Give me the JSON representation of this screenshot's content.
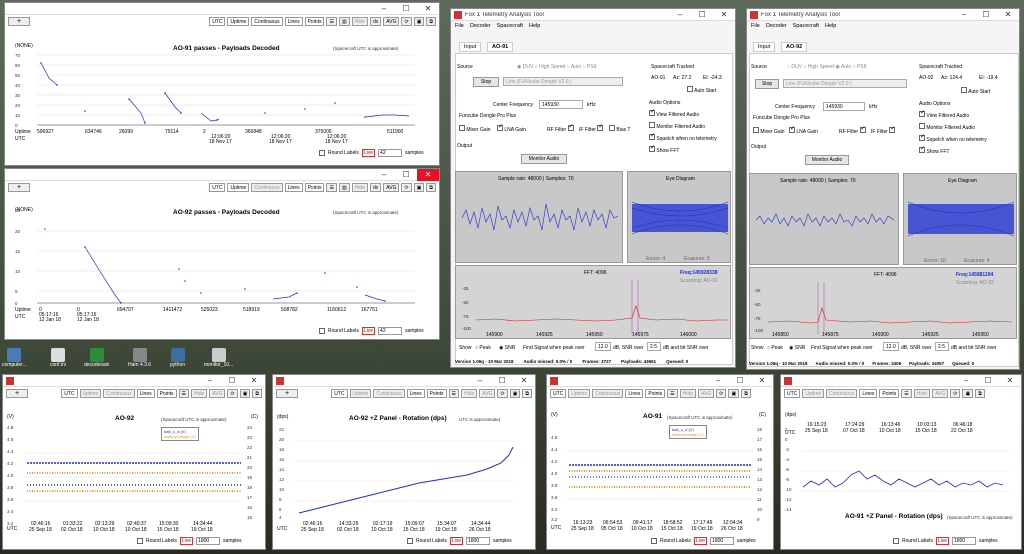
{
  "desktop_icons": [
    "computer...",
    "conf.ini",
    "decodesalx",
    "Ham 4.3.6",
    "python",
    "monitor_10..."
  ],
  "w1": {
    "title": "AO-91 passes - Payloads Decoded",
    "note": "(Spacecraft UTC is approximate)",
    "ylabel": "(NONE)",
    "yticks": [
      "70",
      "60",
      "50",
      "40",
      "30",
      "20",
      "10",
      "0"
    ],
    "toolbar": [
      "UTC",
      "Uptime",
      "Continuous",
      "Lines",
      "Points",
      "Hide",
      "AVG"
    ],
    "xlabels_top": [
      "Uptime",
      "596927",
      "634746",
      "26099",
      "79114",
      "2",
      "366848",
      "375006",
      "511900"
    ],
    "xlabels_utc": [
      "UTC",
      "12:06:20",
      "12:06:20",
      "12:06:20"
    ],
    "xlabels_date": [
      "18 Nov 17",
      "18 Nov 17",
      "18 Nov 17"
    ],
    "round_labels": "Round Labels",
    "live": "Live",
    "samples_value": "42",
    "samples": "samples"
  },
  "w2": {
    "title": "AO-92 passes - Payloads Decoded",
    "note": "(Spacecraft UTC is approximate)",
    "ylabel": "(NONE)",
    "yticks": [
      "25",
      "20",
      "15",
      "10",
      "5",
      "0"
    ],
    "toolbar": [
      "UTC",
      "Uptime",
      "Continuous",
      "Lines",
      "Points",
      "Hide",
      "AVG"
    ],
    "xlabels_top": [
      "Uptime",
      "0",
      "0",
      "694707",
      "1411472",
      "525023",
      "518919",
      "508782",
      "1160612",
      "167751"
    ],
    "xlabels_utc": [
      "UTC",
      "05:17:16",
      "05:17:16"
    ],
    "xlabels_date": [
      "12 Jan 18",
      "12 Jan 18"
    ],
    "round_labels": "Round Labels",
    "live": "Live",
    "samples_value": "42",
    "samples": "samples"
  },
  "f1": {
    "title": "Fox 1 Telemetry Analysis Tool",
    "menu": [
      "File",
      "Decoder",
      "Spacecraft",
      "Help"
    ],
    "tabs": [
      "Input",
      "AO-91"
    ],
    "source": "Source",
    "modes": [
      "DUV",
      "High Speed",
      "Auto",
      "PSK"
    ],
    "stop": "Stop",
    "device": "Line (FUNcube Dongle V2.0 )",
    "sc_tracked": "Spacecraft Tracked",
    "sc_name": "AO-91",
    "az": "Az: 27.2",
    "el": "El: -24.3",
    "auto_start": "Auto Start",
    "audio_options": "Audio Options",
    "audio_opts": [
      "View Filtered Audio",
      "Monitor Filtered Audio",
      "Squelch when no telemetry",
      "Show FFT"
    ],
    "center_freq_label": "Center Frequency",
    "center_freq": "145930",
    "khz": "kHz",
    "funcube": "Funcube Dongle Pro Plus",
    "fc_opts": [
      "Mixer Gain",
      "LNA Gain",
      "RF Filter",
      "IF Filter",
      "Bias T"
    ],
    "output": "Output",
    "monitor_audio": "Monitor Audio",
    "sample_rate": "Sample rate: 48000 | Samples: 70",
    "eye": "Eye Diagram",
    "errors": "Errors: 4",
    "erasures": "Erasures: 0",
    "fft": "FFT: 4096",
    "freq": "Freq:145928338",
    "scanning": "Scanning: AO-91",
    "fft_y": [
      "-25",
      "-50",
      "-75",
      "-100"
    ],
    "fft_x": [
      "145900",
      "145925",
      "145950",
      "145975",
      "146000"
    ],
    "show": "Show",
    "peak": "Peak",
    "snr": "SNR",
    "find_signal": "Find Signal when peak over",
    "peak_val": "12.0",
    "db_snr": "dB, SNR over",
    "snr_val": "2.5",
    "db_bit": "dB and bit SNR over",
    "status": [
      "Version 1.06q - 10 Mar 2018",
      "Audio missed: 0.0% / 0",
      "Frames: 3727",
      "Payloads: 43661",
      "Queued: 0"
    ]
  },
  "f2": {
    "title": "Fox 1 Telemetry Analysis Tool",
    "menu": [
      "File",
      "Decoder",
      "Spacecraft",
      "Help"
    ],
    "tabs": [
      "Input",
      "AO-92"
    ],
    "sc_name": "AO-92",
    "az": "Az: 124.4",
    "el": "El: -19.4",
    "center_freq": "145930",
    "sample_rate": "Sample rate: 48000 | Samples: 70",
    "errors": "Errors: 10",
    "erasures": "Erasures: 4",
    "freq": "Freq:145881194",
    "scanning": "Scanning: AO-92",
    "fft_x": [
      "145850",
      "145875",
      "145900",
      "145925",
      "145950"
    ],
    "peak_val": "12.0",
    "snr_val": "2.5",
    "status": [
      "Version 1.06q - 10 Mar 2018",
      "Audio missed: 0.0% / 0",
      "Frames: 3409",
      "Payloads: 34057",
      "Queued: 0"
    ]
  },
  "b1": {
    "title": "AO-92",
    "note": "(Spacecraft UTC is approximate)",
    "yl": "(V)",
    "yr": "(C)",
    "yticks_l": [
      "4.8",
      "4.6",
      "4.4",
      "4.2",
      "4.0",
      "3.8",
      "3.6",
      "3.4",
      "3.2"
    ],
    "yticks_r": [
      "24",
      "23",
      "22",
      "21",
      "20",
      "19",
      "18",
      "17",
      "16",
      "15",
      "14",
      "13",
      "12"
    ],
    "legend": [
      "batt_c_d (V)",
      "batteryvoltage (C)"
    ],
    "xlabels": [
      "02:46:16",
      "01:33:22",
      "02:13:29",
      "02:40:37",
      "15:09:30",
      "14:34:44",
      "14:34:44"
    ],
    "xdates": [
      "25 Sep 18",
      "02 Oct 18",
      "10 Oct 18",
      "10 Oct 18",
      "15 Oct 18",
      "19 Oct 18",
      "26 Oct 18"
    ],
    "utc": "UTC",
    "round_labels": "Round Labels",
    "live": "Live",
    "samples_value": "1800",
    "samples": "samples"
  },
  "b2": {
    "title": "AO-92 +Z Panel - Rotation (dps)",
    "note": "UTC is approximate)",
    "yl": "(dps)",
    "yticks": [
      "22",
      "20",
      "18",
      "16",
      "14",
      "12",
      "10",
      "8",
      "6",
      "4"
    ],
    "xlabels": [
      "02:46:16",
      "14:33:29",
      "02:17:19",
      "15:09:07",
      "15:34:07",
      "14:34:44"
    ],
    "xdates": [
      "25 Sep 18",
      "02 Oct 18",
      "10 Oct 18",
      "15 Oct 18",
      "19 Oct 18",
      "26 Oct 18"
    ],
    "utc": "UTC",
    "round_labels": "Round Labels",
    "live": "Live",
    "samples_value": "1800",
    "samples": "samples"
  },
  "b3": {
    "title": "AO-91",
    "note": "(Spacecraft UTC is approximate)",
    "yl": "(V)",
    "yr": "(C)",
    "yticks_l": [
      "4.6",
      "4.4",
      "4.2",
      "4.0",
      "3.8",
      "3.6",
      "3.4",
      "3.2"
    ],
    "yticks_r": [
      "18",
      "17",
      "16",
      "15",
      "14",
      "13",
      "12",
      "11",
      "10",
      "9",
      "8"
    ],
    "legend": [
      "batt_c_d (V)",
      "batteryvoltage (C)"
    ],
    "xlabels": [
      "16:13:23",
      "06:54:53",
      "09:41:17",
      "18:58:52",
      "17:17:49",
      "12:04:34"
    ],
    "xdates": [
      "25 Sep 18",
      "05 Oct 18",
      "10 Oct 18",
      "15 Oct 18",
      "19 Oct 18",
      "26 Oct 18"
    ],
    "utc": "UTC",
    "round_labels": "Round Labels",
    "live": "Live",
    "samples_value": "1800",
    "samples": "samples"
  },
  "b4": {
    "title": "AO-91 +Z Panel - Rotation (dps)",
    "note": "(Spacecraft UTC is approximate)",
    "yl": "(dps)",
    "yticks": [
      "2",
      "0",
      "-2",
      "-4",
      "-6",
      "-8",
      "-10",
      "-12",
      "-14",
      "-16",
      "-18"
    ],
    "xlabels": [
      "16:15:23",
      "17:24:29",
      "16:13:46",
      "10:03:13",
      "06:46:18"
    ],
    "xdates": [
      "25 Sep 18",
      "07 Oct 18",
      "10 Oct 18",
      "15 Oct 18",
      "22 Oct 18"
    ],
    "utc": "UTC",
    "round_labels": "Round Labels",
    "live": "Live",
    "samples_value": "1800",
    "samples": "samples"
  },
  "colors": {
    "blue": "#1c2fd6",
    "orange": "#e89a2a",
    "red_close": "#e81123",
    "grid": "#c9c9c9"
  }
}
